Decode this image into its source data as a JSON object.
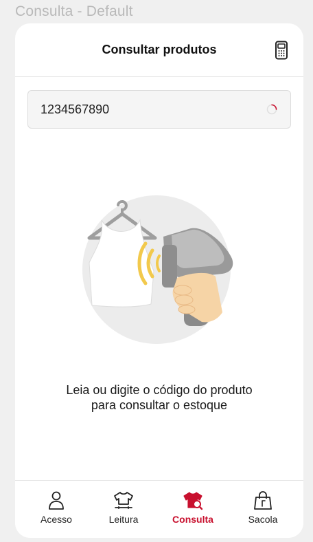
{
  "window": {
    "title": "Consulta - Default"
  },
  "header": {
    "title": "Consultar produtos",
    "device_icon": "scanner-device-icon"
  },
  "search": {
    "value": "1234567890",
    "loading": true
  },
  "illustration": {
    "icon": "barcode-scanner-illustration"
  },
  "helper": {
    "line1": "Leia ou digite o código do produto",
    "line2": "para consultar o estoque"
  },
  "colors": {
    "accent": "#c8102e",
    "illustration_bg": "#ececec",
    "signal": "#f2c94c"
  },
  "tabs": [
    {
      "label": "Acesso",
      "icon": "user-icon",
      "active": false
    },
    {
      "label": "Leitura",
      "icon": "shirt-icon",
      "active": false
    },
    {
      "label": "Consulta",
      "icon": "shirt-search-icon",
      "active": true
    },
    {
      "label": "Sacola",
      "icon": "bag-icon",
      "active": false
    }
  ]
}
